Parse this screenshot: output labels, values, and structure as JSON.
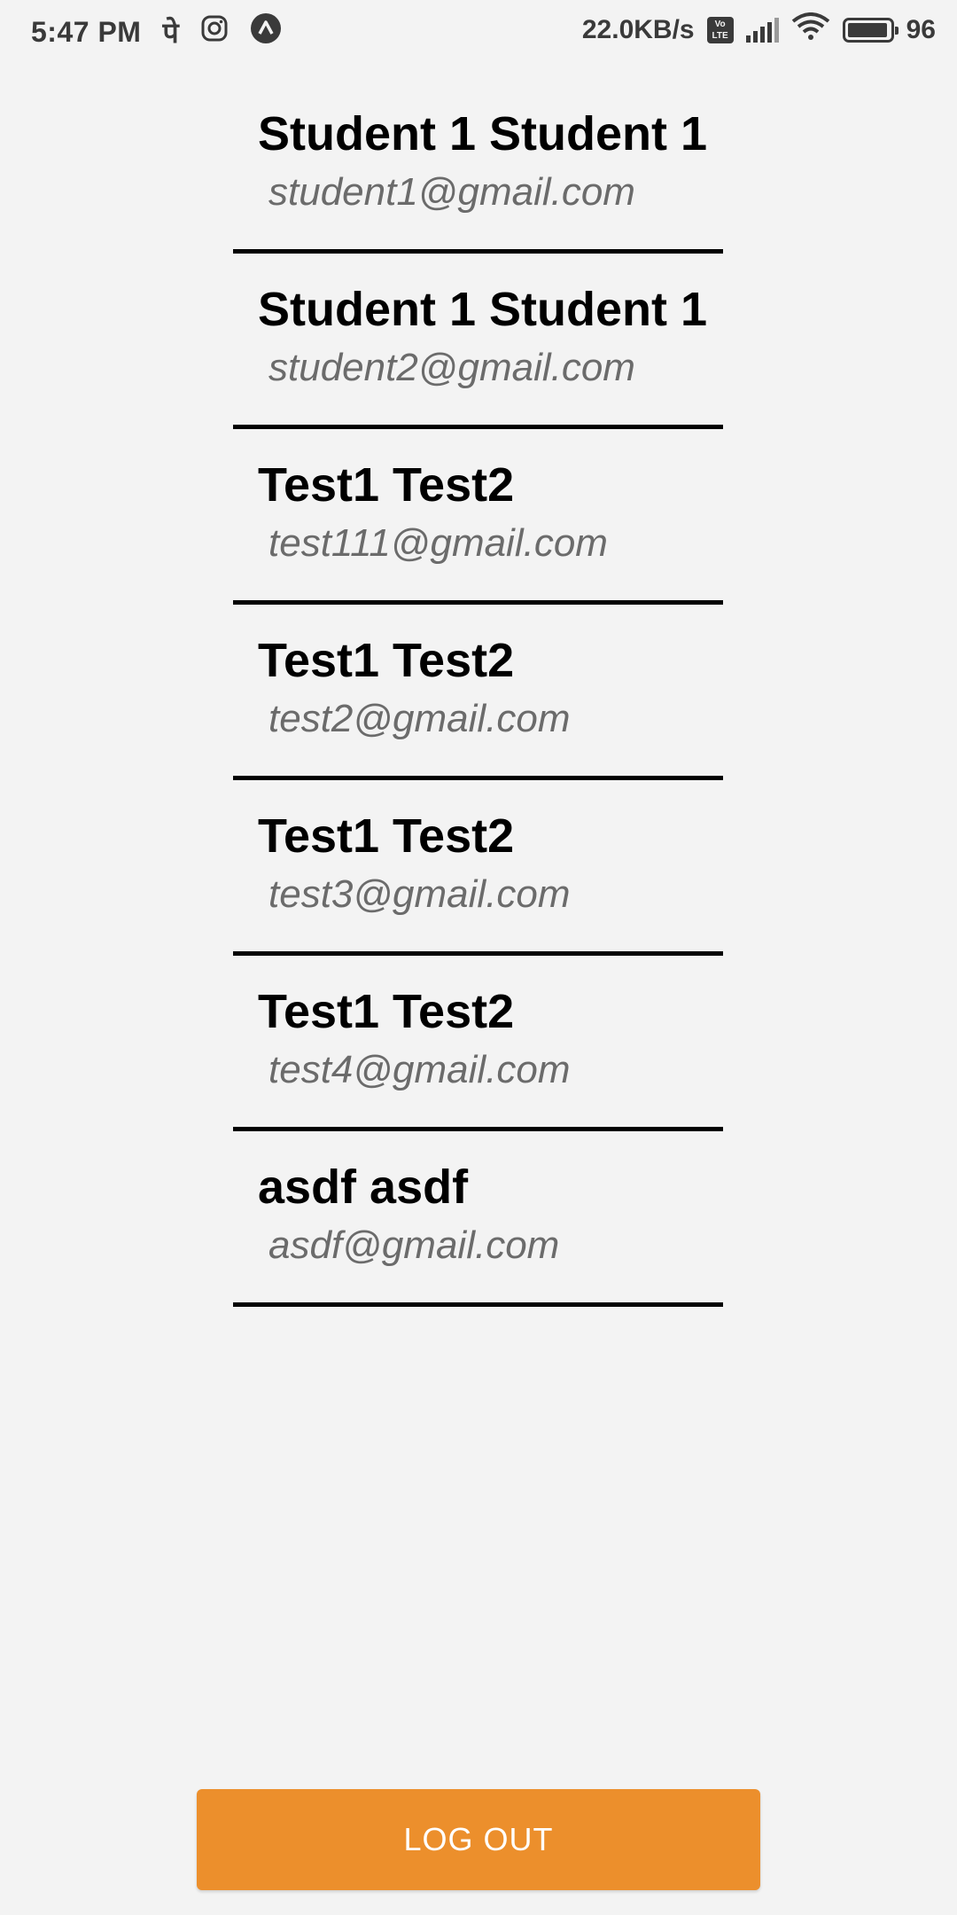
{
  "status_bar": {
    "time": "5:47 PM",
    "notif_glyph_1": "पे",
    "network_speed": "22.0KB/s",
    "volte_label": "Vo LTE",
    "battery_percent": "96",
    "icons": [
      "phonepe-icon",
      "instagram-icon",
      "expo-icon",
      "volte-icon",
      "signal-icon",
      "wifi-icon",
      "battery-icon"
    ]
  },
  "users": [
    {
      "name": "Student 1 Student 1",
      "email": "student1@gmail.com"
    },
    {
      "name": "Student 1 Student 1",
      "email": "student2@gmail.com"
    },
    {
      "name": "Test1 Test2",
      "email": "test111@gmail.com"
    },
    {
      "name": "Test1 Test2",
      "email": "test2@gmail.com"
    },
    {
      "name": "Test1 Test2",
      "email": "test3@gmail.com"
    },
    {
      "name": "Test1 Test2",
      "email": "test4@gmail.com"
    },
    {
      "name": "asdf asdf",
      "email": "asdf@gmail.com"
    }
  ],
  "logout_button": {
    "label": "LOG OUT",
    "color": "#ec8f2c"
  }
}
